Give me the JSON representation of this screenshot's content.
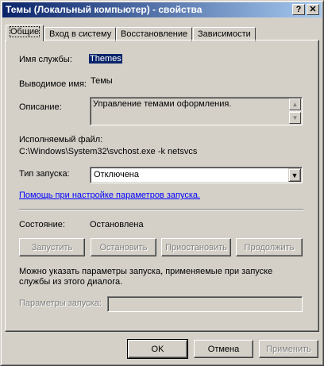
{
  "window": {
    "title": "Темы (Локальный компьютер) - свойства",
    "help_button": "?",
    "close_button": "✕"
  },
  "tabs": [
    {
      "label": "Общие",
      "active": true
    },
    {
      "label": "Вход в систему",
      "active": false
    },
    {
      "label": "Восстановление",
      "active": false
    },
    {
      "label": "Зависимости",
      "active": false
    }
  ],
  "general": {
    "service_name_label": "Имя службы:",
    "service_name_value": "Themes",
    "display_name_label": "Выводимое имя:",
    "display_name_value": "Темы",
    "description_label": "Описание:",
    "description_value": "Управление темами оформления.",
    "executable_label": "Исполняемый файл:",
    "executable_value": "C:\\Windows\\System32\\svchost.exe -k netsvcs",
    "startup_type_label": "Тип запуска:",
    "startup_type_value": "Отключена",
    "help_link": "Помощь при настройке параметров запуска.",
    "status_label": "Состояние:",
    "status_value": "Остановлена",
    "buttons": {
      "start": "Запустить",
      "stop": "Остановить",
      "pause": "Приостановить",
      "resume": "Продолжить"
    },
    "params_hint": "Можно указать параметры запуска, применяемые при запуске службы из этого диалога.",
    "params_label": "Параметры запуска:",
    "params_value": ""
  },
  "footer": {
    "ok": "OK",
    "cancel": "Отмена",
    "apply": "Применить"
  },
  "colors": {
    "title_gradient_start": "#0a246a",
    "title_gradient_end": "#a6caf0",
    "face": "#d4d0c8",
    "link": "#0000ff"
  }
}
